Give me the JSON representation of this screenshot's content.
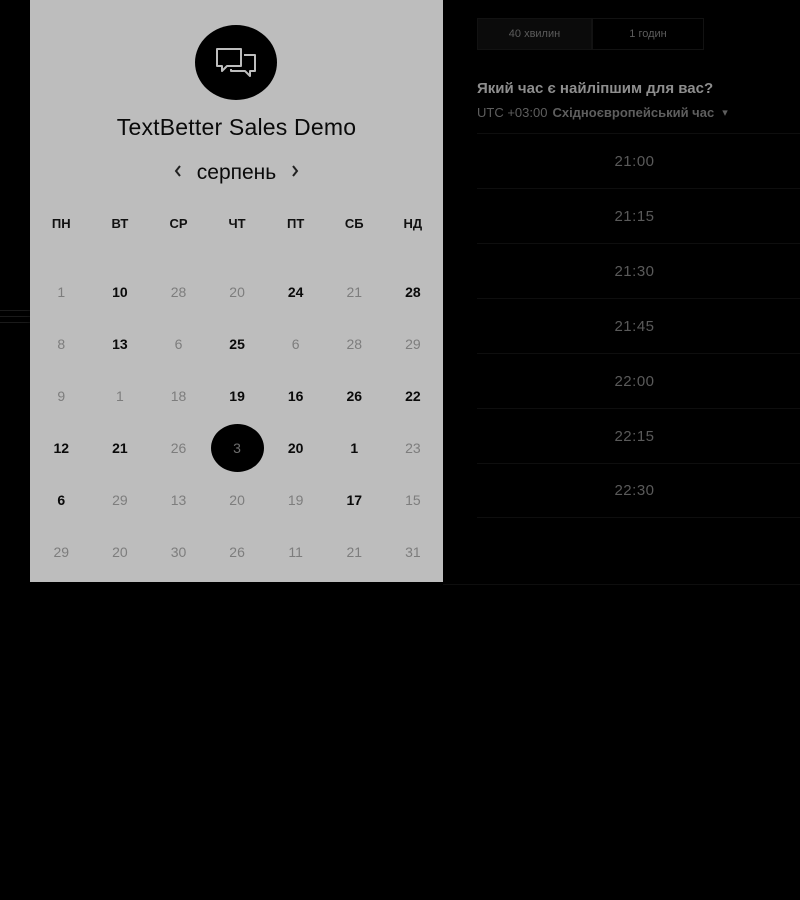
{
  "company": {
    "name": "TextBetter Sales Demo",
    "logo_icon": "chat-bubbles-icon"
  },
  "calendar": {
    "month": "серпень",
    "prev_icon": "chevron-left-icon",
    "next_icon": "chevron-right-icon",
    "weekdays": [
      "ПН",
      "ВТ",
      "СР",
      "ЧТ",
      "ПТ",
      "СБ",
      "НД"
    ],
    "days": [
      {
        "label": "1",
        "available": false
      },
      {
        "label": "10",
        "available": true
      },
      {
        "label": "28",
        "available": false
      },
      {
        "label": "20",
        "available": false
      },
      {
        "label": "24",
        "available": true
      },
      {
        "label": "21",
        "available": false
      },
      {
        "label": "28",
        "available": true
      },
      {
        "label": "8",
        "available": false
      },
      {
        "label": "13",
        "available": true
      },
      {
        "label": "6",
        "available": false
      },
      {
        "label": "25",
        "available": true
      },
      {
        "label": "6",
        "available": false
      },
      {
        "label": "28",
        "available": false
      },
      {
        "label": "29",
        "available": false
      },
      {
        "label": "9",
        "available": false
      },
      {
        "label": "1",
        "available": false
      },
      {
        "label": "18",
        "available": false
      },
      {
        "label": "19",
        "available": true
      },
      {
        "label": "16",
        "available": true
      },
      {
        "label": "26",
        "available": true
      },
      {
        "label": "22",
        "available": true
      },
      {
        "label": "12",
        "available": true
      },
      {
        "label": "21",
        "available": true
      },
      {
        "label": "26",
        "available": false
      },
      {
        "label": "3",
        "available": true,
        "selected": true
      },
      {
        "label": "20",
        "available": true
      },
      {
        "label": "1",
        "available": true
      },
      {
        "label": "23",
        "available": false
      },
      {
        "label": "6",
        "available": true
      },
      {
        "label": "29",
        "available": false
      },
      {
        "label": "13",
        "available": false
      },
      {
        "label": "20",
        "available": false
      },
      {
        "label": "19",
        "available": false
      },
      {
        "label": "17",
        "available": true
      },
      {
        "label": "15",
        "available": false
      },
      {
        "label": "29",
        "available": false
      },
      {
        "label": "20",
        "available": false
      },
      {
        "label": "30",
        "available": false
      },
      {
        "label": "26",
        "available": false
      },
      {
        "label": "11",
        "available": false
      },
      {
        "label": "21",
        "available": false
      },
      {
        "label": "31",
        "available": false
      }
    ]
  },
  "duration": {
    "options": [
      "40 хвилин",
      "1 годин"
    ]
  },
  "question": "Який час є найліпшим для вас?",
  "timezone": {
    "offset": "UTC +03:00",
    "name": "Східноєвропейський час",
    "chevron_icon": "chevron-down-icon"
  },
  "time_slots": [
    "21:00",
    "21:15",
    "21:30",
    "21:45",
    "22:00",
    "22:15",
    "22:30"
  ],
  "colors": {
    "card_bg": "#bdbdbd",
    "page_bg": "#000000",
    "available_day": "#0a0a0a",
    "unavailable_day": "#7d7d7d",
    "selected_day_bg": "#000000"
  }
}
